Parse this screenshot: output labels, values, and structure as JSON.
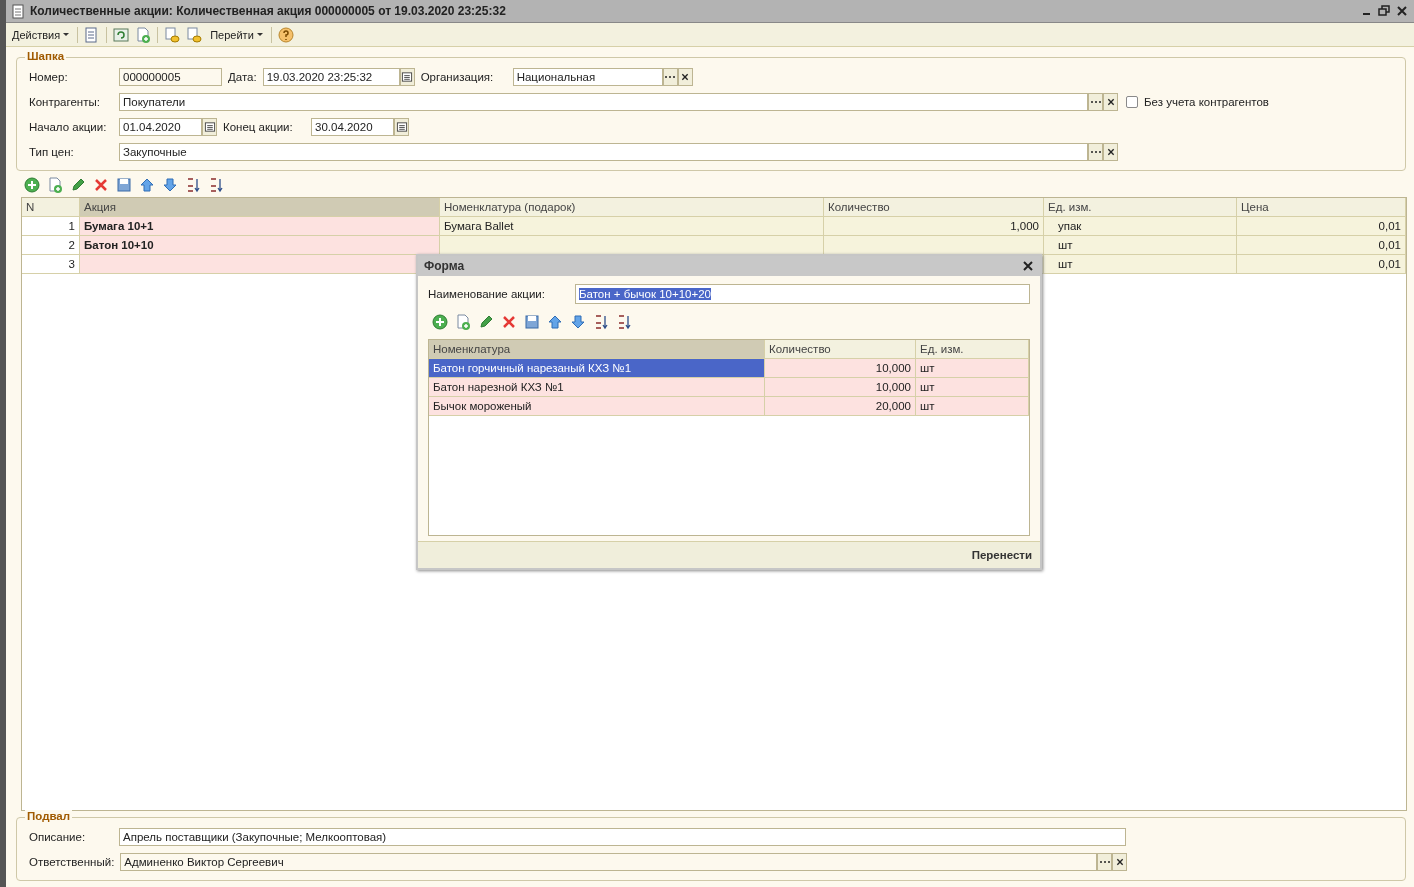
{
  "window": {
    "title": "Количественные акции: Количественная акция 000000005 от 19.03.2020 23:25:32"
  },
  "toolbar": {
    "menus": [
      "Действия",
      "Перейти"
    ]
  },
  "header": {
    "legend": "Шапка",
    "number": {
      "label": "Номер:",
      "value": "000000005"
    },
    "date": {
      "label": "Дата:",
      "value": "19.03.2020 23:25:32"
    },
    "organization": {
      "label": "Организация:",
      "value": "Национальная"
    },
    "counterparties": {
      "label": "Контрагенты:",
      "value": "Покупатели"
    },
    "without_counterparties": {
      "label": "Без учета контрагентов",
      "checked": false
    },
    "start": {
      "label": "Начало акции:",
      "value": "01.04.2020"
    },
    "end": {
      "label": "Конец акции:",
      "value": "30.04.2020"
    },
    "price_type": {
      "label": "Тип цен:",
      "value": "Закупочные"
    }
  },
  "table": {
    "columns": [
      "N",
      "Акция",
      "Номенклатура (подарок)",
      "Количество",
      "Ед. изм.",
      "Цена"
    ],
    "rows": [
      {
        "n": "1",
        "action": "Бумага 10+1",
        "gift": "Бумага Ballet",
        "quantity": "1,000",
        "unit": "упак",
        "price": "0,01"
      },
      {
        "n": "2",
        "action": "Батон 10+10",
        "unit": "шт",
        "price": "0,01"
      },
      {
        "n": "3",
        "unit": "шт",
        "price": "0,01"
      }
    ]
  },
  "dialog": {
    "title": "Форма",
    "name_label": "Наименование акции:",
    "name_value": "Батон + бычок 10+10+20",
    "name_text_selected": true,
    "columns": [
      "Номенклатура",
      "Количество",
      "Ед. изм."
    ],
    "rows": [
      {
        "name": "Батон горчичный нарезаный КХЗ №1",
        "quantity": "10,000",
        "unit": "шт",
        "selected": true
      },
      {
        "name": "Батон нарезной КХЗ №1",
        "quantity": "10,000",
        "unit": "шт",
        "selected": false
      },
      {
        "name": "Бычок мороженый",
        "quantity": "20,000",
        "unit": "шт",
        "selected": false
      }
    ],
    "button": "Перенести"
  },
  "footer": {
    "legend": "Подвал",
    "description": {
      "label": "Описание:",
      "value": "Апрель поставщики (Закупочные; Мелкооптовая)"
    },
    "responsible": {
      "label": "Ответственный:",
      "value": "Админенко Виктор Сергеевич"
    }
  }
}
